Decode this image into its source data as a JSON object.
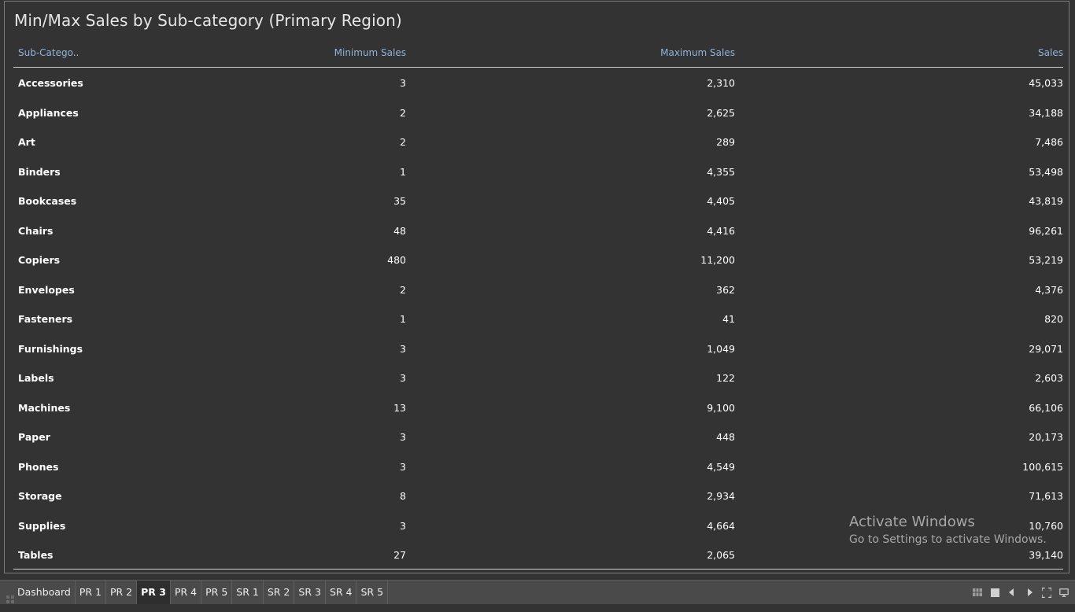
{
  "title": "Min/Max Sales by Sub-category (Primary Region)",
  "table": {
    "headers": [
      "Sub-Catego..",
      "Minimum Sales",
      "Maximum Sales",
      "Sales"
    ],
    "rows": [
      [
        "Accessories",
        "3",
        "2,310",
        "45,033"
      ],
      [
        "Appliances",
        "2",
        "2,625",
        "34,188"
      ],
      [
        "Art",
        "2",
        "289",
        "7,486"
      ],
      [
        "Binders",
        "1",
        "4,355",
        "53,498"
      ],
      [
        "Bookcases",
        "35",
        "4,405",
        "43,819"
      ],
      [
        "Chairs",
        "48",
        "4,416",
        "96,261"
      ],
      [
        "Copiers",
        "480",
        "11,200",
        "53,219"
      ],
      [
        "Envelopes",
        "2",
        "362",
        "4,376"
      ],
      [
        "Fasteners",
        "1",
        "41",
        "820"
      ],
      [
        "Furnishings",
        "3",
        "1,049",
        "29,071"
      ],
      [
        "Labels",
        "3",
        "122",
        "2,603"
      ],
      [
        "Machines",
        "13",
        "9,100",
        "66,106"
      ],
      [
        "Paper",
        "3",
        "448",
        "20,173"
      ],
      [
        "Phones",
        "3",
        "4,549",
        "100,615"
      ],
      [
        "Storage",
        "8",
        "2,934",
        "71,613"
      ],
      [
        "Supplies",
        "3",
        "4,664",
        "10,760"
      ],
      [
        "Tables",
        "27",
        "2,065",
        "39,140"
      ]
    ]
  },
  "watermark": {
    "title": "Activate Windows",
    "subtitle": "Go to Settings to activate Windows."
  },
  "tabs": [
    {
      "label": "Dashboard",
      "active": false
    },
    {
      "label": "PR 1",
      "active": false
    },
    {
      "label": "PR 2",
      "active": false
    },
    {
      "label": "PR 3",
      "active": true
    },
    {
      "label": "PR 4",
      "active": false
    },
    {
      "label": "PR 5",
      "active": false
    },
    {
      "label": "SR 1",
      "active": false
    },
    {
      "label": "SR 2",
      "active": false
    },
    {
      "label": "SR 3",
      "active": false
    },
    {
      "label": "SR 4",
      "active": false
    },
    {
      "label": "SR 5",
      "active": false
    }
  ],
  "controls": [
    "tab-grid-icon",
    "single-view-icon",
    "previous-icon",
    "next-icon",
    "fullscreen-icon",
    "presentation-icon"
  ],
  "colors": {
    "background": "#333333",
    "header_text": "#8fb4d9",
    "body_text": "#ffffff",
    "active_tab": "#2e2e2e"
  }
}
